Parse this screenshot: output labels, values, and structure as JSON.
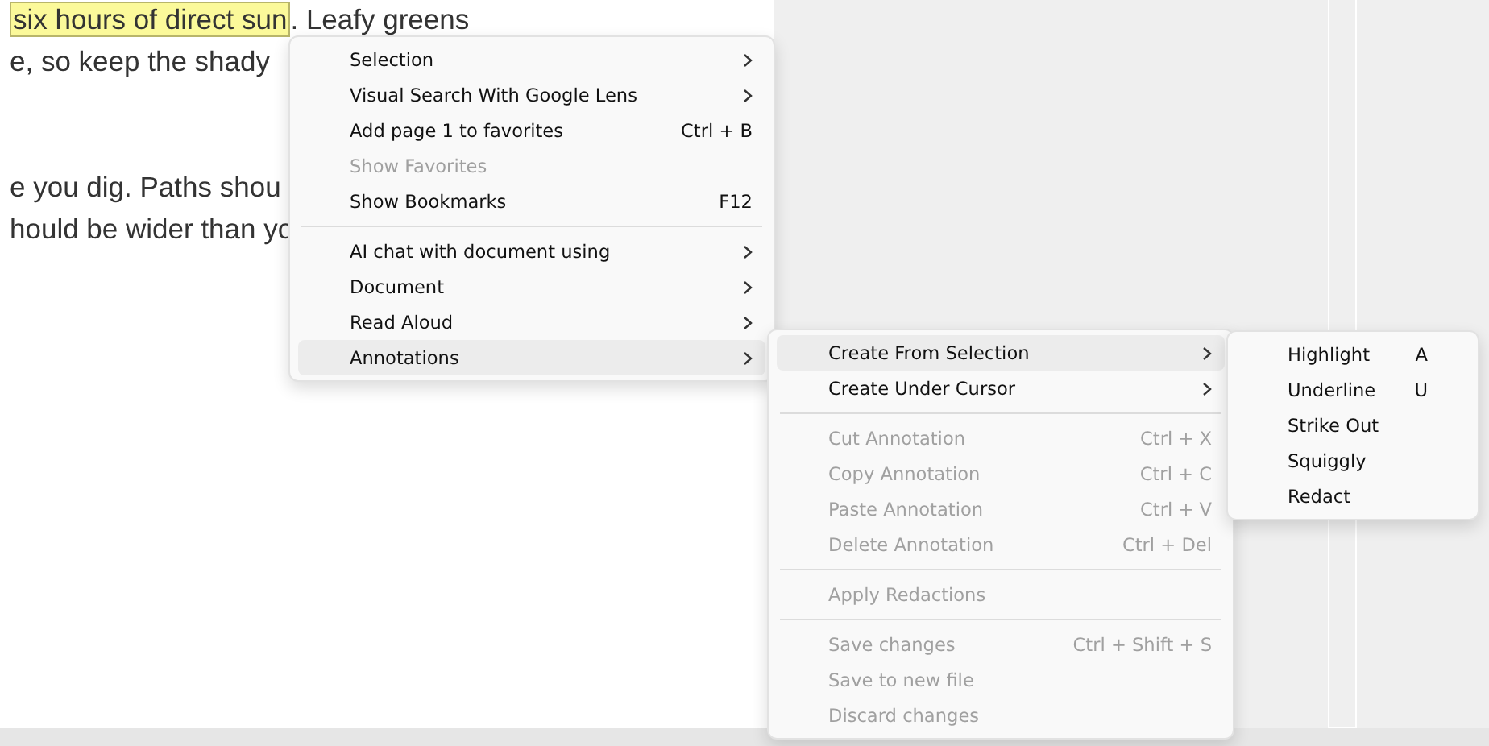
{
  "document": {
    "paragraphs": [
      {
        "lines": [
          {
            "parts": [
              {
                "text": "six hours of direct sun",
                "highlighted": true
              },
              {
                "text": ". Leafy greens",
                "highlighted": false
              }
            ]
          },
          {
            "parts": [
              {
                "text": "e, so keep the shady",
                "highlighted": false
              }
            ]
          }
        ]
      },
      {
        "lines": [
          {
            "parts": [
              {
                "text": "e you dig. Paths shou",
                "highlighted": false
              }
            ]
          },
          {
            "parts": [
              {
                "text": "hould be wider than yo",
                "highlighted": false
              }
            ]
          }
        ]
      }
    ]
  },
  "menus": [
    {
      "items": [
        {
          "kind": "item",
          "label": "Selection",
          "submenu": true,
          "disabled": false,
          "selected": false
        },
        {
          "kind": "item",
          "label": "Visual Search With Google Lens",
          "submenu": true,
          "disabled": false,
          "selected": false
        },
        {
          "kind": "item",
          "label": "Add page 1 to favorites",
          "shortcut": "Ctrl + B",
          "submenu": false,
          "disabled": false,
          "selected": false
        },
        {
          "kind": "item",
          "label": "Show Favorites",
          "submenu": false,
          "disabled": true,
          "selected": false
        },
        {
          "kind": "item",
          "label": "Show Bookmarks",
          "shortcut": "F12",
          "submenu": false,
          "disabled": false,
          "selected": false
        },
        {
          "kind": "separator"
        },
        {
          "kind": "item",
          "label": "AI chat with document using",
          "submenu": true,
          "disabled": false,
          "selected": false
        },
        {
          "kind": "item",
          "label": "Document",
          "submenu": true,
          "disabled": false,
          "selected": false
        },
        {
          "kind": "item",
          "label": "Read Aloud",
          "submenu": true,
          "disabled": false,
          "selected": false
        },
        {
          "kind": "item",
          "label": "Annotations",
          "submenu": true,
          "disabled": false,
          "selected": true
        }
      ]
    },
    {
      "items": [
        {
          "kind": "item",
          "label": "Create From Selection",
          "submenu": true,
          "disabled": false,
          "selected": true
        },
        {
          "kind": "item",
          "label": "Create Under Cursor",
          "submenu": true,
          "disabled": false,
          "selected": false
        },
        {
          "kind": "separator"
        },
        {
          "kind": "item",
          "label": "Cut Annotation",
          "shortcut": "Ctrl + X",
          "submenu": false,
          "disabled": true,
          "selected": false
        },
        {
          "kind": "item",
          "label": "Copy Annotation",
          "shortcut": "Ctrl + C",
          "submenu": false,
          "disabled": true,
          "selected": false
        },
        {
          "kind": "item",
          "label": "Paste Annotation",
          "shortcut": "Ctrl + V",
          "submenu": false,
          "disabled": true,
          "selected": false
        },
        {
          "kind": "item",
          "label": "Delete Annotation",
          "shortcut": "Ctrl + Del",
          "submenu": false,
          "disabled": true,
          "selected": false
        },
        {
          "kind": "separator"
        },
        {
          "kind": "item",
          "label": "Apply Redactions",
          "submenu": false,
          "disabled": true,
          "selected": false
        },
        {
          "kind": "separator"
        },
        {
          "kind": "item",
          "label": "Save changes",
          "shortcut": "Ctrl + Shift + S",
          "submenu": false,
          "disabled": true,
          "selected": false
        },
        {
          "kind": "item",
          "label": "Save to new file",
          "submenu": false,
          "disabled": true,
          "selected": false
        },
        {
          "kind": "item",
          "label": "Discard changes",
          "submenu": false,
          "disabled": true,
          "selected": false
        }
      ]
    },
    {
      "items": [
        {
          "kind": "item",
          "label": "Highlight",
          "shortcut": "A",
          "submenu": false,
          "disabled": false,
          "selected": false
        },
        {
          "kind": "item",
          "label": "Underline",
          "shortcut": "U",
          "submenu": false,
          "disabled": false,
          "selected": false
        },
        {
          "kind": "item",
          "label": "Strike Out",
          "submenu": false,
          "disabled": false,
          "selected": false
        },
        {
          "kind": "item",
          "label": "Squiggly",
          "submenu": false,
          "disabled": false,
          "selected": false
        },
        {
          "kind": "item",
          "label": "Redact",
          "submenu": false,
          "disabled": false,
          "selected": false
        }
      ]
    }
  ]
}
